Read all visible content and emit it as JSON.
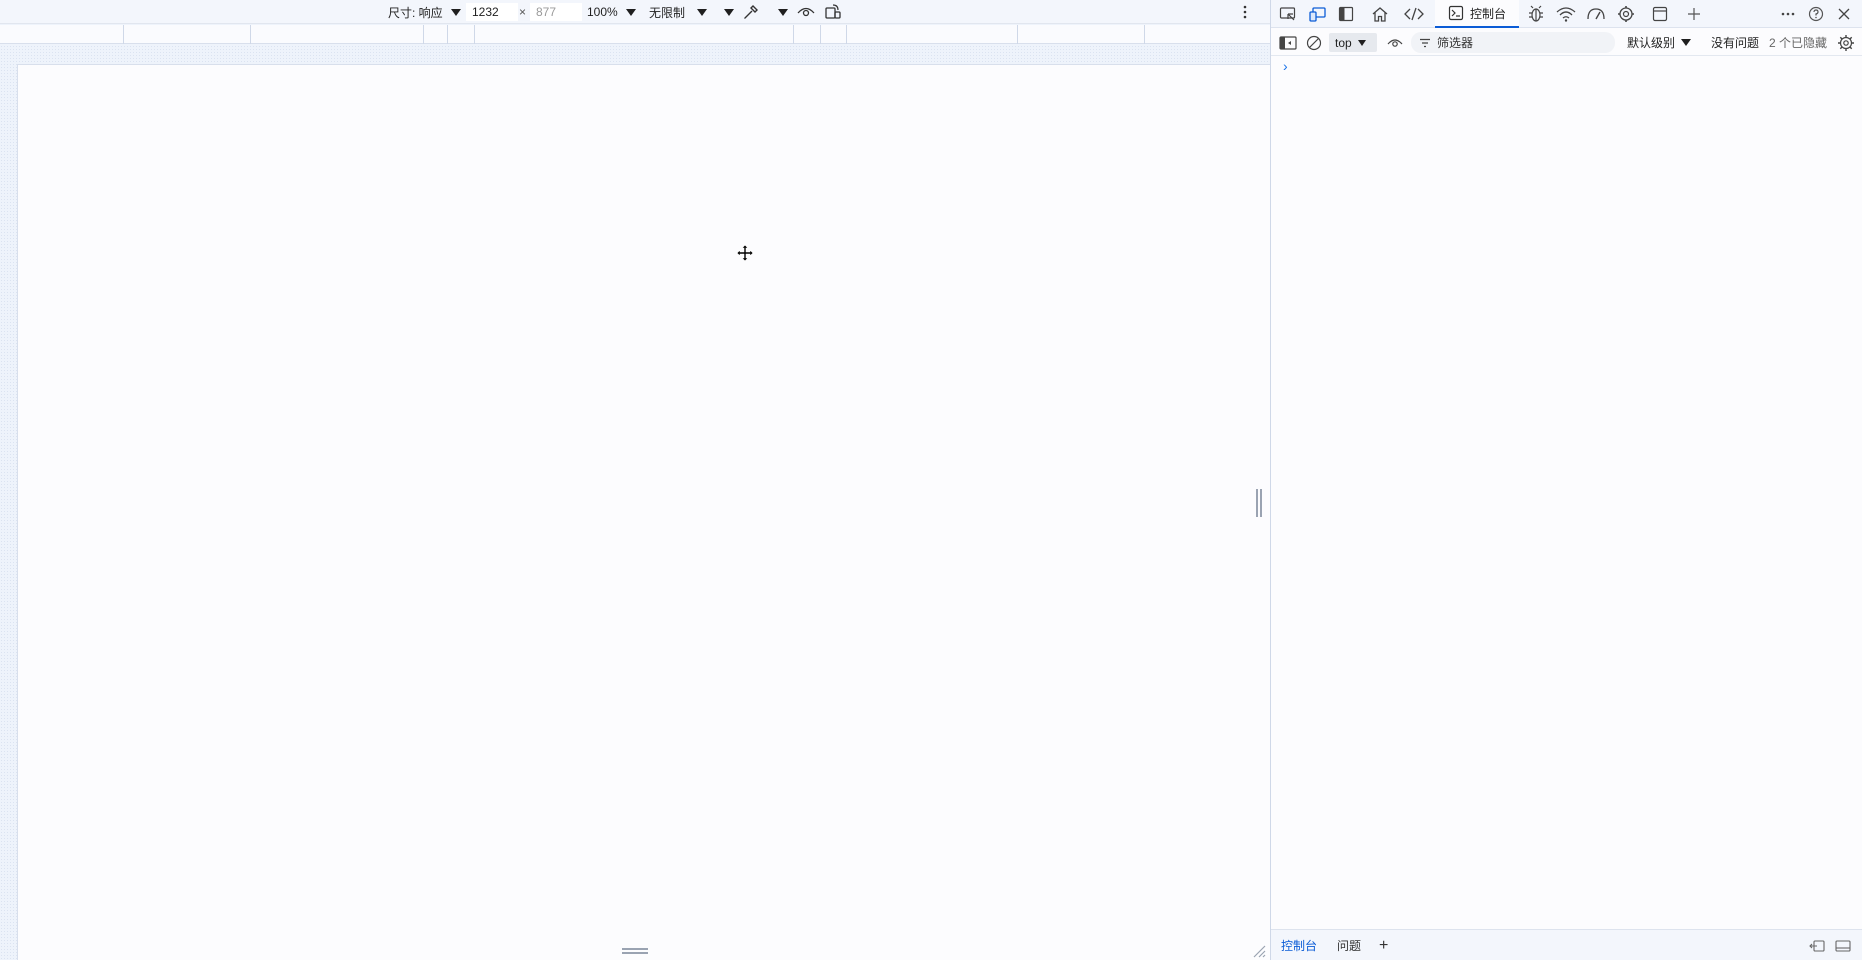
{
  "emulation_toolbar": {
    "dimensions_label": "尺寸: 响应",
    "width_value": "1232",
    "times_sign": "×",
    "height_value": "877",
    "zoom": "100%",
    "throttling": "无限制",
    "icons": [
      "chevron-down-icon",
      "eyedropper-icon",
      "eye-icon",
      "rotate-device-icon",
      "more-vertical-icon"
    ]
  },
  "devtools": {
    "tabs": {
      "console_label": "控制台",
      "icons": [
        "inspect-icon",
        "device-emulation-icon",
        "dock-icon",
        "home-icon",
        "elements-code-icon",
        "console-icon",
        "bug-icon",
        "wifi-network-icon",
        "performance-gauge-icon",
        "settings-gear-icon",
        "application-window-icon",
        "plus-icon",
        "more-horizontal-icon",
        "help-icon",
        "close-icon"
      ]
    },
    "console_bar": {
      "context": "top",
      "filter_placeholder": "筛选器",
      "level": "默认级别",
      "issues": "没有问题",
      "hidden_count": "2 个已隐藏"
    },
    "prompt": "›",
    "drawer": {
      "console_tab": "控制台",
      "issues_tab": "问题",
      "add": "+"
    }
  },
  "colors": {
    "accent": "#0b5cd6",
    "toolbar_bg": "#f3f6fc",
    "panel_bg": "#fcfcfe"
  }
}
